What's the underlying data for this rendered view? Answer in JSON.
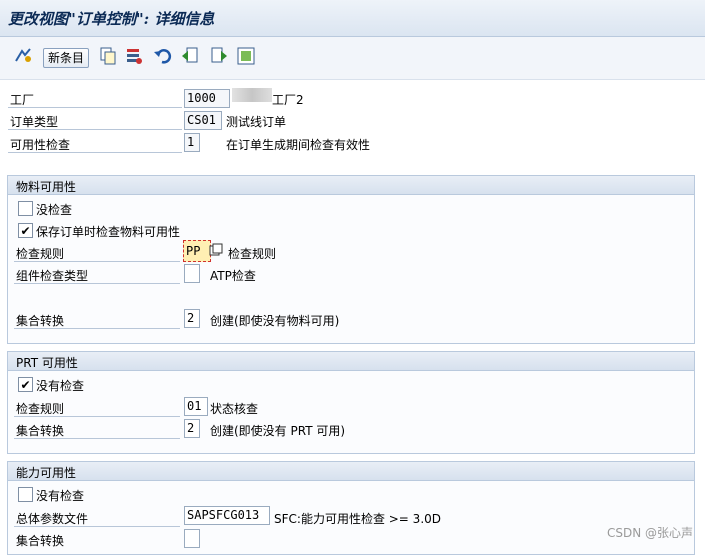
{
  "title": "更改视图\"订单控制\": 详细信息",
  "toolbar": {
    "new_entries_label": "新条目",
    "icons": [
      "display-change-icon",
      "copy-icon",
      "delete-icon",
      "undo-icon",
      "previous-entry-icon",
      "next-entry-icon",
      "select-icon"
    ]
  },
  "header": {
    "plant_label": "工厂",
    "plant_value": "1000",
    "plant_desc": "工厂2",
    "order_type_label": "订单类型",
    "order_type_value": "CS01",
    "order_type_desc": "测试线订单",
    "avail_check_label": "可用性检查",
    "avail_check_value": "1",
    "avail_check_desc": "在订单生成期间检查有效性"
  },
  "material": {
    "title": "物料可用性",
    "no_check_label": "没检查",
    "no_check_checked": false,
    "check_on_save_label": "保存订单时检查物料可用性",
    "check_on_save_checked": true,
    "check_rule_label": "检查规则",
    "check_rule_value": "PP",
    "check_rule_desc": "检查规则",
    "component_type_label": "组件检查类型",
    "component_type_value": "",
    "component_type_desc": "ATP检查",
    "collective_conv_label": "集合转换",
    "collective_conv_value": "2",
    "collective_conv_desc": "创建(即使没有物料可用)"
  },
  "prt": {
    "title": "PRT 可用性",
    "no_check_label": "没有检查",
    "no_check_checked": true,
    "check_rule_label": "检查规则",
    "check_rule_value": "01",
    "check_rule_desc": "状态核查",
    "collective_conv_label": "集合转换",
    "collective_conv_value": "2",
    "collective_conv_desc": "创建(即使没有 PRT 可用)"
  },
  "capacity": {
    "title": "能力可用性",
    "no_check_label": "没有检查",
    "no_check_checked": false,
    "overall_profile_label": "总体参数文件",
    "overall_profile_value": "SAPSFCG013",
    "overall_profile_desc": "SFC:能力可用性检查 >= 3.0D",
    "collective_conv_label": "集合转换",
    "collective_conv_value": ""
  },
  "watermark": "CSDN @张心声"
}
